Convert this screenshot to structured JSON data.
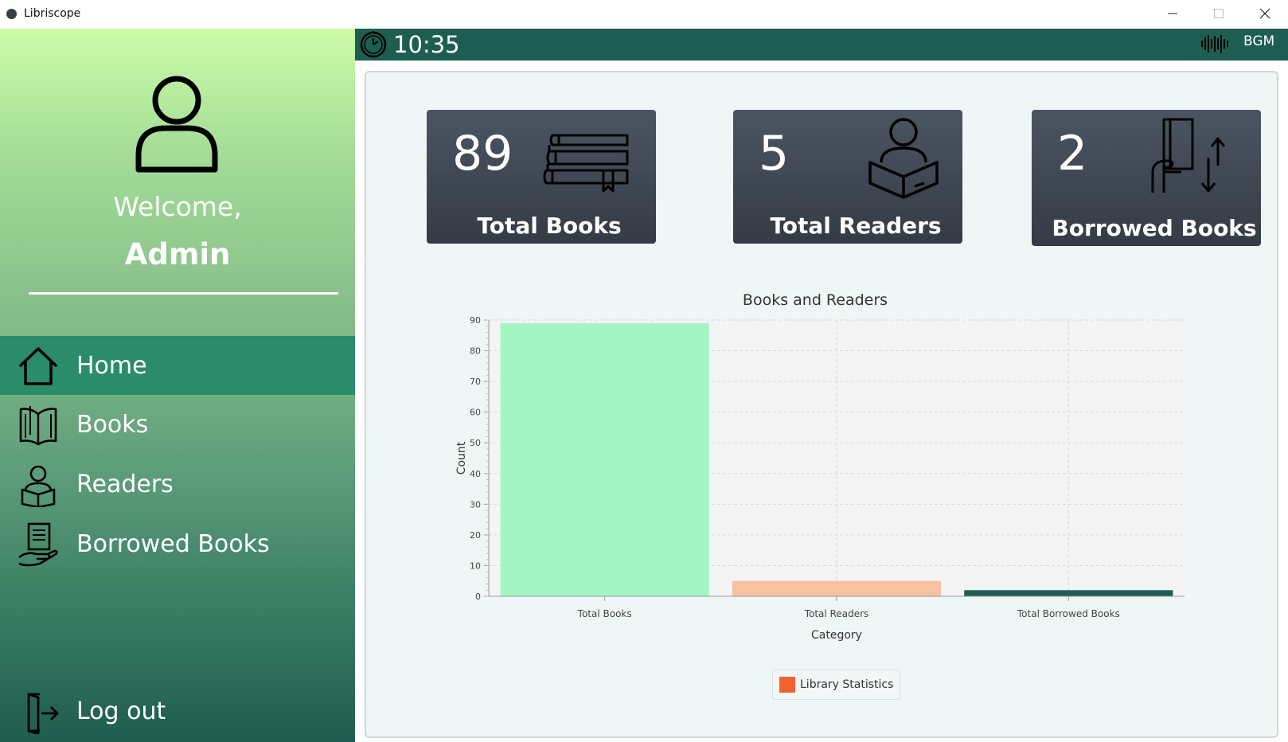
{
  "window": {
    "title": "Libriscope",
    "controls": {
      "minimize_icon": "minimize-icon",
      "maximize_icon": "maximize-icon",
      "close_icon": "close-icon"
    }
  },
  "sidebar": {
    "avatar_icon": "user-icon",
    "welcome": "Welcome,",
    "user_name": "Admin",
    "items": [
      {
        "label": "Home",
        "icon": "home-icon",
        "active": true
      },
      {
        "label": "Books",
        "icon": "open-book-icon",
        "active": false
      },
      {
        "label": "Readers",
        "icon": "reader-icon",
        "active": false
      },
      {
        "label": "Borrowed Books",
        "icon": "borrowed-book-icon",
        "active": false
      }
    ],
    "logout": {
      "label": "Log out",
      "icon": "logout-icon"
    }
  },
  "topbar": {
    "clock_icon": "clock-icon",
    "time": "10:35",
    "music_icon": "sound-wave-icon",
    "bgm_label": "BGM"
  },
  "stats": {
    "total_books": {
      "value": "89",
      "label": "Total Books",
      "icon": "books-stack-icon"
    },
    "total_readers": {
      "value": "5",
      "label": "Total Readers",
      "icon": "reader-book-icon"
    },
    "borrowed_books": {
      "value": "2",
      "label": "Borrowed Books",
      "icon": "book-exchange-icon"
    }
  },
  "colors": {
    "sidebar_active": "#2a8c6a",
    "topbar": "#1e5e52",
    "card": "#3f4752",
    "bar_1": "#a4f5c4",
    "bar_2": "#f7c1a2",
    "bar_3": "#1e5e52",
    "legend_swatch": "#f2622e"
  },
  "chart_data": {
    "type": "bar",
    "title": "Books and Readers",
    "xlabel": "Category",
    "ylabel": "Count",
    "categories": [
      "Total Books",
      "Total Readers",
      "Total Borrowed Books"
    ],
    "series": [
      {
        "name": "Library Statistics",
        "values": [
          89,
          5,
          2
        ]
      }
    ],
    "ylim": [
      0,
      90
    ],
    "yticks": [
      0,
      10,
      20,
      30,
      40,
      50,
      60,
      70,
      80,
      90
    ],
    "grid": true,
    "legend": "bottom-center"
  }
}
